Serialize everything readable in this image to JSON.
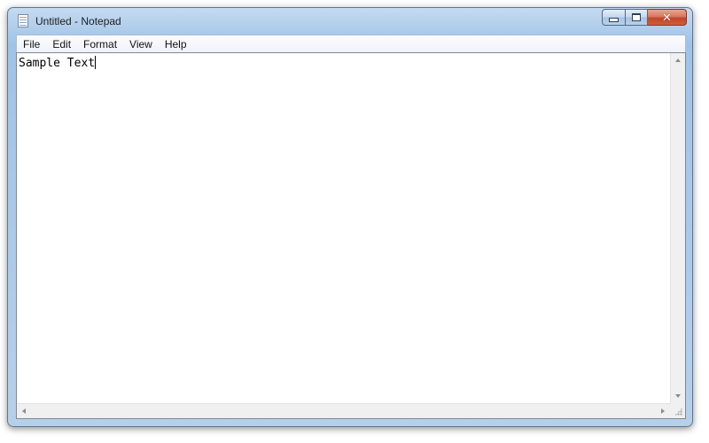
{
  "window": {
    "title": "Untitled - Notepad",
    "icon": "notepad-icon"
  },
  "menu": {
    "items": [
      "File",
      "Edit",
      "Format",
      "View",
      "Help"
    ]
  },
  "editor": {
    "content": "Sample Text"
  },
  "caption_buttons": {
    "minimize_icon": "minimize-icon",
    "maximize_icon": "maximize-icon",
    "close_icon": "close-icon",
    "close_color": "#c1462a"
  },
  "scrollbars": {
    "vertical": true,
    "horizontal": true
  }
}
